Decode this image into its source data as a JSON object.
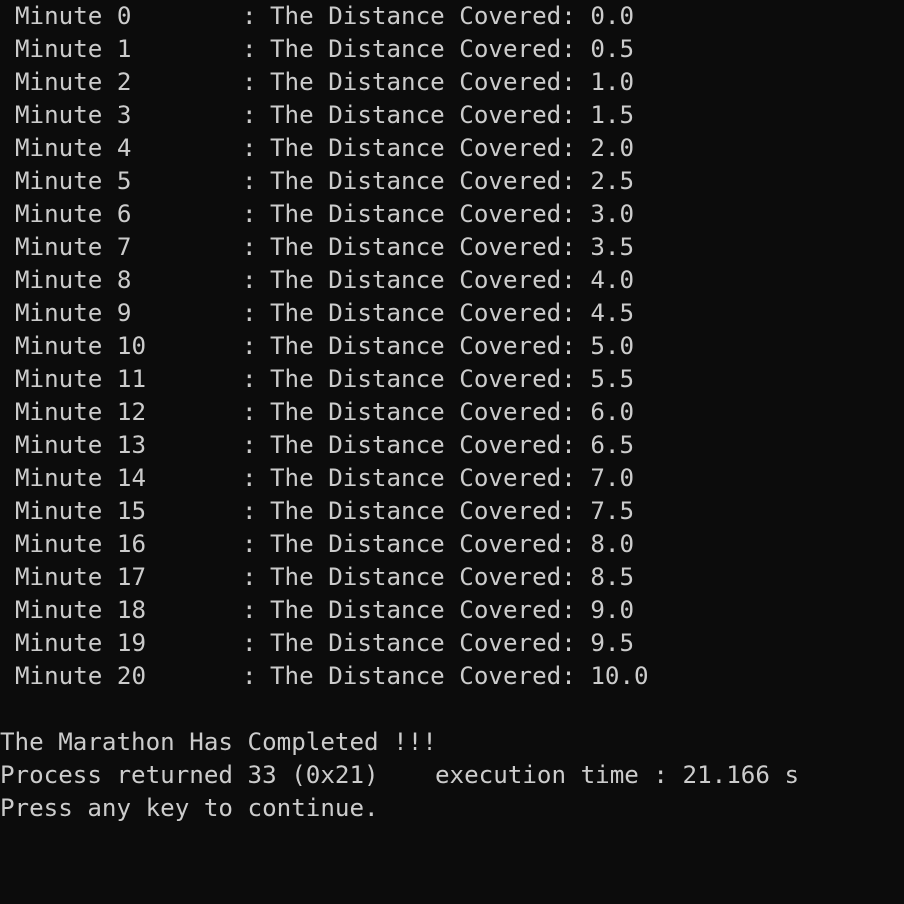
{
  "console": {
    "rows": [
      {
        "minute": "Minute 0",
        "label": "The Distance Covered:",
        "value": "0.0"
      },
      {
        "minute": "Minute 1",
        "label": "The Distance Covered:",
        "value": "0.5"
      },
      {
        "minute": "Minute 2",
        "label": "The Distance Covered:",
        "value": "1.0"
      },
      {
        "minute": "Minute 3",
        "label": "The Distance Covered:",
        "value": "1.5"
      },
      {
        "minute": "Minute 4",
        "label": "The Distance Covered:",
        "value": "2.0"
      },
      {
        "minute": "Minute 5",
        "label": "The Distance Covered:",
        "value": "2.5"
      },
      {
        "minute": "Minute 6",
        "label": "The Distance Covered:",
        "value": "3.0"
      },
      {
        "minute": "Minute 7",
        "label": "The Distance Covered:",
        "value": "3.5"
      },
      {
        "minute": "Minute 8",
        "label": "The Distance Covered:",
        "value": "4.0"
      },
      {
        "minute": "Minute 9",
        "label": "The Distance Covered:",
        "value": "4.5"
      },
      {
        "minute": "Minute 10",
        "label": "The Distance Covered:",
        "value": "5.0"
      },
      {
        "minute": "Minute 11",
        "label": "The Distance Covered:",
        "value": "5.5"
      },
      {
        "minute": "Minute 12",
        "label": "The Distance Covered:",
        "value": "6.0"
      },
      {
        "minute": "Minute 13",
        "label": "The Distance Covered:",
        "value": "6.5"
      },
      {
        "minute": "Minute 14",
        "label": "The Distance Covered:",
        "value": "7.0"
      },
      {
        "minute": "Minute 15",
        "label": "The Distance Covered:",
        "value": "7.5"
      },
      {
        "minute": "Minute 16",
        "label": "The Distance Covered:",
        "value": "8.0"
      },
      {
        "minute": "Minute 17",
        "label": "The Distance Covered:",
        "value": "8.5"
      },
      {
        "minute": "Minute 18",
        "label": "The Distance Covered:",
        "value": "9.0"
      },
      {
        "minute": "Minute 19",
        "label": "The Distance Covered:",
        "value": "9.5"
      },
      {
        "minute": "Minute 20",
        "label": "The Distance Covered:",
        "value": "10.0"
      }
    ],
    "separator": ":",
    "completion_message": "The Marathon Has Completed !!!",
    "process_returned": "Process returned 33 (0x21)",
    "execution_time": "execution time : 21.166 s",
    "press_any_key": "Press any key to continue."
  },
  "colors": {
    "background": "#0c0c0c",
    "text": "#cccccc"
  }
}
